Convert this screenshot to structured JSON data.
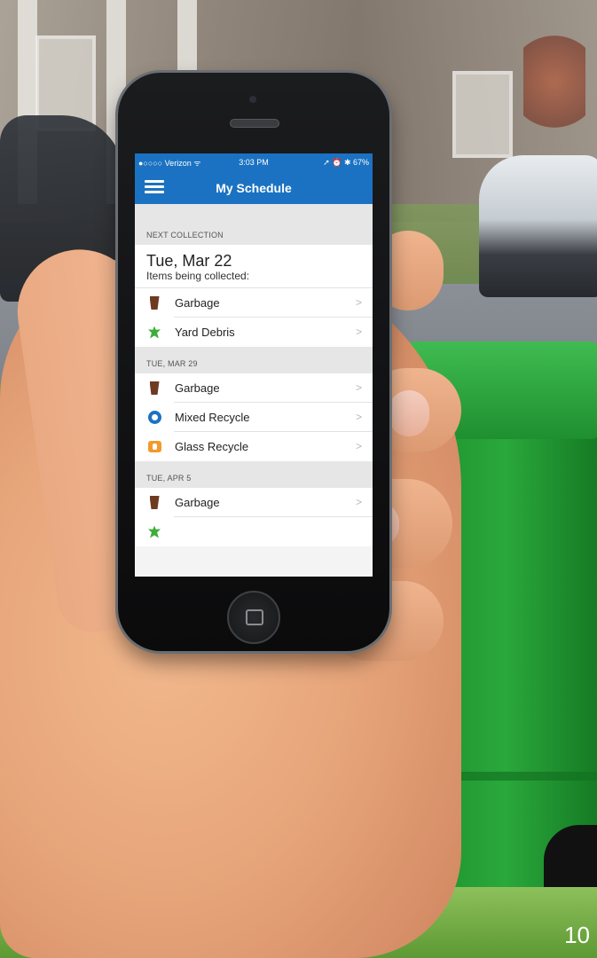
{
  "status_bar": {
    "carrier": "●○○○○ Verizon ᯤ",
    "time": "3:03 PM",
    "indicators": "➚ ⏰ ✱ 67%"
  },
  "navbar": {
    "menu_icon": "hamburger-menu-icon",
    "title": "My Schedule"
  },
  "next_collection": {
    "header": "NEXT COLLECTION",
    "date": "Tue, Mar 22",
    "subtitle": "Items being collected:",
    "items": [
      {
        "label": "Garbage",
        "icon": "garbage-cart-icon",
        "color": "#6e3b21"
      },
      {
        "label": "Yard Debris",
        "icon": "leaf-icon",
        "color": "#3dad3a"
      }
    ]
  },
  "upcoming": [
    {
      "header": "TUE, MAR 29",
      "items": [
        {
          "label": "Garbage",
          "icon": "garbage-cart-icon"
        },
        {
          "label": "Mixed Recycle",
          "icon": "recycle-icon",
          "color": "#1b72c2"
        },
        {
          "label": "Glass Recycle",
          "icon": "glass-bin-icon",
          "color": "#f29a2e"
        }
      ]
    },
    {
      "header": "TUE, APR 5",
      "items": [
        {
          "label": "Garbage",
          "icon": "garbage-cart-icon"
        }
      ]
    }
  ],
  "chevron": ">",
  "page_number": "10",
  "colors": {
    "accent": "#1b72c2",
    "bin_green": "#23a236"
  }
}
